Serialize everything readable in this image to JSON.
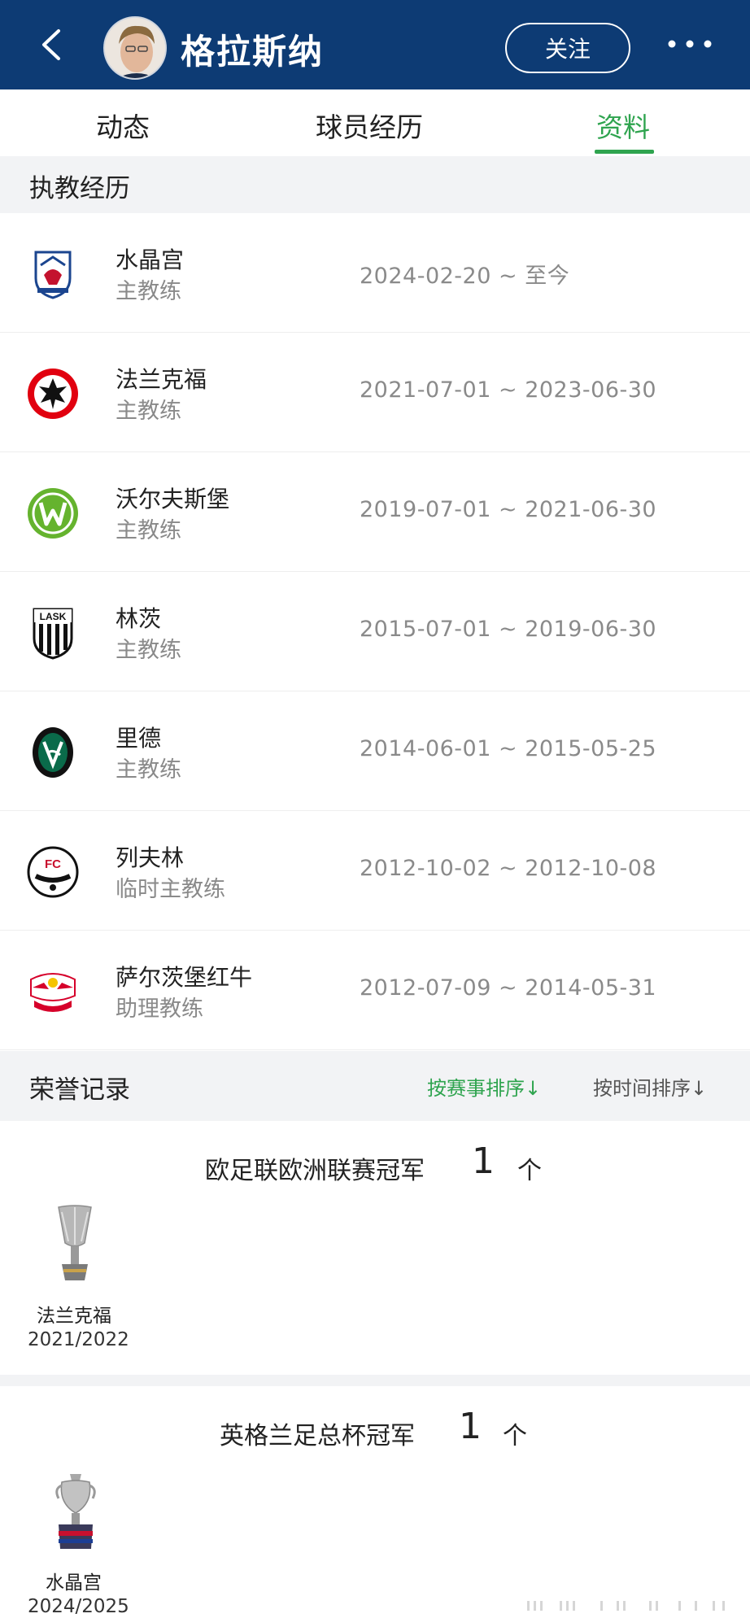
{
  "header": {
    "title": "格拉斯纳",
    "follow_label": "关注",
    "back_icon": "chevron-left-icon",
    "more_icon": "more-dots-icon"
  },
  "tabs": [
    {
      "label": "动态",
      "active": false
    },
    {
      "label": "球员经历",
      "active": false
    },
    {
      "label": "资料",
      "active": true
    }
  ],
  "coaching": {
    "section_title": "执教经历",
    "items": [
      {
        "club": "水晶宫",
        "role": "主教练",
        "dates": "2024-02-20 ~ 至今",
        "logo": "crystal-palace-logo-icon"
      },
      {
        "club": "法兰克福",
        "role": "主教练",
        "dates": "2021-07-01 ~ 2023-06-30",
        "logo": "frankfurt-logo-icon"
      },
      {
        "club": "沃尔夫斯堡",
        "role": "主教练",
        "dates": "2019-07-01 ~ 2021-06-30",
        "logo": "wolfsburg-logo-icon"
      },
      {
        "club": "林茨",
        "role": "主教练",
        "dates": "2015-07-01 ~ 2019-06-30",
        "logo": "lask-logo-icon"
      },
      {
        "club": "里德",
        "role": "主教练",
        "dates": "2014-06-01 ~ 2015-05-25",
        "logo": "ried-logo-icon"
      },
      {
        "club": "列夫林",
        "role": "临时主教练",
        "dates": "2012-10-02 ~ 2012-10-08",
        "logo": "liefering-logo-icon"
      },
      {
        "club": "萨尔茨堡红牛",
        "role": "助理教练",
        "dates": "2012-07-09 ~ 2014-05-31",
        "logo": "salzburg-logo-icon"
      }
    ]
  },
  "honours": {
    "section_title": "荣誉记录",
    "sort_by_competition": "按赛事排序↓",
    "sort_by_time": "按时间排序↓",
    "groups": [
      {
        "title": "欧足联欧洲联赛冠军",
        "count": "1",
        "unit": "个",
        "club": "法兰克福",
        "season": "2021/2022",
        "icon": "europa-league-trophy-icon"
      },
      {
        "title": "英格兰足总杯冠军",
        "count": "1",
        "unit": "个",
        "club": "水晶宫",
        "season": "2024/2025",
        "icon": "fa-cup-trophy-icon"
      }
    ]
  },
  "colors": {
    "header_bg": "#0d3b74",
    "accent_green": "#2fa44f",
    "muted_gray": "#8a8a8a",
    "section_bg": "#f2f3f5"
  }
}
